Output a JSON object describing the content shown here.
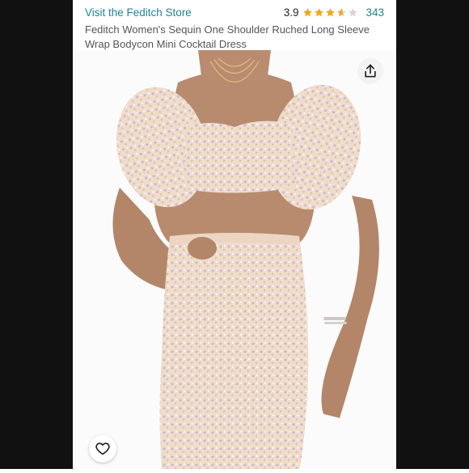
{
  "header": {
    "store_link": "Visit the Feditch Store",
    "rating_value": "3.9",
    "rating_stars": 3.9,
    "rating_count": "343",
    "product_title": "Feditch Women's Sequin One Shoulder Ruched Long Sleeve Wrap Bodycon Mini Cocktail Dress"
  },
  "colors": {
    "link": "#1f8397",
    "star": "#f3a61b",
    "star_empty": "#d6d6d6"
  },
  "icons": {
    "share": "share-icon",
    "favorite": "heart-icon"
  }
}
